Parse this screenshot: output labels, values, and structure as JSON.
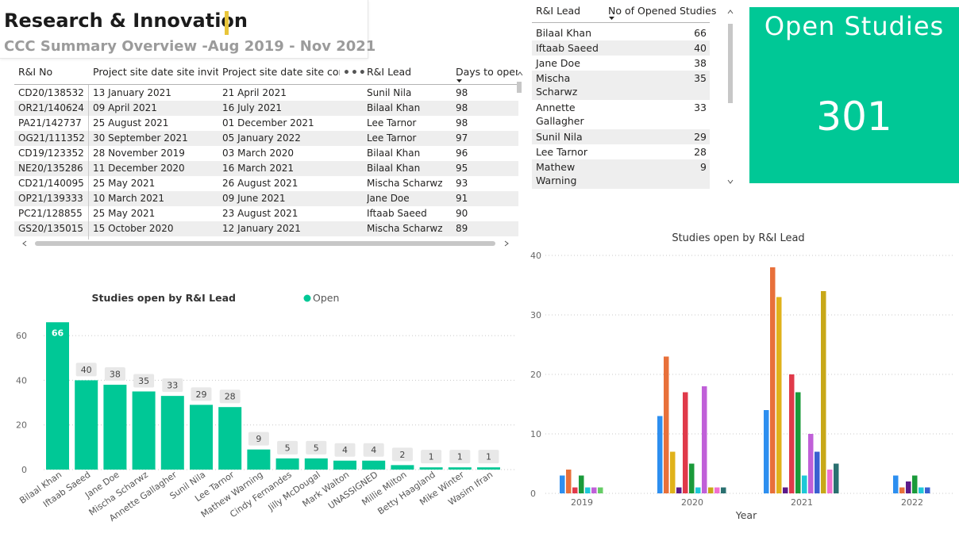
{
  "header": {
    "title": "Research & Innovation",
    "subtitle": "CCC Summary Overview -Aug 2019 - Nov 2021"
  },
  "projects_table": {
    "columns": [
      "R&I No",
      "Project site date site invited",
      "Project site date site confir",
      "R&I Lead",
      "Days to open"
    ],
    "rows": [
      [
        "CD20/138532",
        "13 January 2021",
        "21 April 2021",
        "Sunil Nila",
        "98"
      ],
      [
        "OR21/140624",
        "09 April 2021",
        "16 July 2021",
        "Bilaal Khan",
        "98"
      ],
      [
        "PA21/142737",
        "25 August 2021",
        "01 December 2021",
        "Lee Tarnor",
        "98"
      ],
      [
        "OG21/111352",
        "30 September 2021",
        "05 January 2022",
        "Lee Tarnor",
        "97"
      ],
      [
        "CD19/123352",
        "28 November 2019",
        "03 March 2020",
        "Bilaal Khan",
        "96"
      ],
      [
        "NE20/135286",
        "11 December 2020",
        "16 March 2021",
        "Bilaal Khan",
        "95"
      ],
      [
        "CD21/140095",
        "25 May 2021",
        "26 August 2021",
        "Mischa Scharwz",
        "93"
      ],
      [
        "OP21/139333",
        "10 March 2021",
        "09 June 2021",
        "Jane Doe",
        "91"
      ],
      [
        "PC21/128855",
        "25 May 2021",
        "23 August 2021",
        "Iftaab Saeed",
        "90"
      ],
      [
        "GS20/135015",
        "15 October 2020",
        "12 January 2021",
        "Mischa Scharwz",
        "89"
      ]
    ]
  },
  "lead_table": {
    "columns": [
      "R&I Lead",
      "No of Opened Studies"
    ],
    "rows": [
      [
        "Bilaal Khan",
        "66"
      ],
      [
        "Iftaab Saeed",
        "40"
      ],
      [
        "Jane Doe",
        "38"
      ],
      [
        "Mischa Scharwz",
        "35"
      ],
      [
        "Annette Gallagher",
        "33"
      ],
      [
        "Sunil Nila",
        "29"
      ],
      [
        "Lee Tarnor",
        "28"
      ],
      [
        "Mathew Warning",
        "9"
      ]
    ]
  },
  "kpi": {
    "title": "Open Studies",
    "value": "301",
    "color": "#00c896"
  },
  "chart_data": [
    {
      "type": "bar",
      "title": "Studies open by R&I Lead",
      "legend": [
        "Open"
      ],
      "legend_placement": "top",
      "color": "#00c896",
      "categories": [
        "Bilaal Khan",
        "Iftaab Saeed",
        "Jane Doe",
        "Mischa Scharwz",
        "Annette Gallagher",
        "Sunil Nila",
        "Lee Tarnor",
        "Mathew Warning",
        "Cindy Fernandes",
        "Jilly McDougal",
        "Mark Walton",
        "UNASSIGNED",
        "Millie Milton",
        "Betty Haagland",
        "Mike Winter",
        "Wasim Ifran"
      ],
      "values": [
        66,
        40,
        38,
        35,
        33,
        29,
        28,
        9,
        5,
        5,
        4,
        4,
        2,
        1,
        1,
        1
      ],
      "yticks": [
        0,
        20,
        40,
        60
      ],
      "ylim": [
        0,
        70
      ],
      "grid": true
    },
    {
      "type": "bar",
      "title": "Studies open by R&I Lead",
      "xlabel": "Year",
      "ylabel": "",
      "categories": [
        "2019",
        "2020",
        "2021",
        "2022"
      ],
      "yticks": [
        0,
        10,
        20,
        30,
        40
      ],
      "ylim": [
        0,
        40
      ],
      "grid": true,
      "series": [
        {
          "color": "#2d8ff0",
          "values": [
            3,
            13,
            14,
            3
          ]
        },
        {
          "color": "#e8703a",
          "values": [
            4,
            23,
            38,
            1
          ]
        },
        {
          "color": "#e0b21a",
          "values": [
            0,
            7,
            33,
            0
          ]
        },
        {
          "color": "#5c1a8a",
          "values": [
            0,
            1,
            1,
            2
          ]
        },
        {
          "color": "#e03a4a",
          "values": [
            1,
            17,
            20,
            0
          ]
        },
        {
          "color": "#1a9a3a",
          "values": [
            3,
            5,
            17,
            3
          ]
        },
        {
          "color": "#1ec8d8",
          "values": [
            1,
            1,
            3,
            1
          ]
        },
        {
          "color": "#c060d8",
          "values": [
            1,
            18,
            10,
            0
          ]
        },
        {
          "color": "#66cc66",
          "values": [
            1,
            0,
            0,
            0
          ]
        },
        {
          "color": "#3a5fd0",
          "values": [
            0,
            0,
            7,
            1
          ]
        },
        {
          "color": "#c8a818",
          "values": [
            0,
            1,
            34,
            0
          ]
        },
        {
          "color": "#f070d0",
          "values": [
            0,
            1,
            4,
            0
          ]
        },
        {
          "color": "#2a7070",
          "values": [
            0,
            1,
            5,
            0
          ]
        }
      ]
    }
  ]
}
